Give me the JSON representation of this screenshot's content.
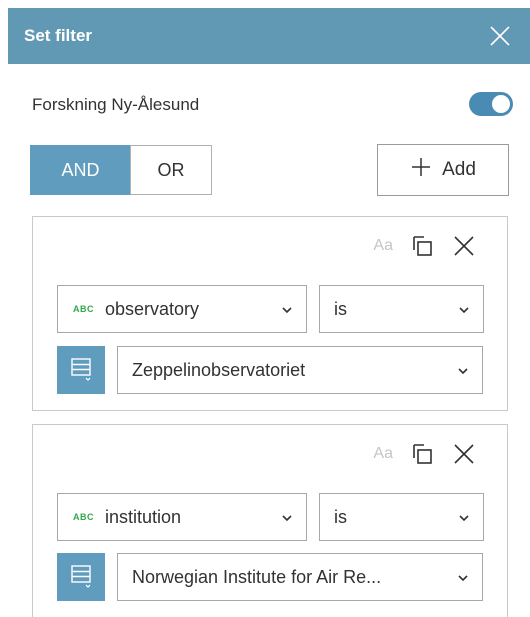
{
  "dialog": {
    "title": "Set filter",
    "close_icon": "close-icon"
  },
  "layer": {
    "name": "Forskning Ny-Ålesund",
    "enabled": true
  },
  "logic": {
    "options": [
      "AND",
      "OR"
    ],
    "selected": "AND"
  },
  "add_button": {
    "label": "Add",
    "icon": "plus-icon"
  },
  "colors": {
    "header": "#6199b4",
    "accent": "#5f9cbd",
    "toggle": "#4a8bb3",
    "string_type": "#2ea84a"
  },
  "filters": [
    {
      "field_type": "ABC",
      "field": "observatory",
      "operator": "is",
      "value": "Zeppelinobservatoriet",
      "case_label": "Aa"
    },
    {
      "field_type": "ABC",
      "field": "institution",
      "operator": "is",
      "value": "Norwegian Institute for Air Re...",
      "case_label": "Aa"
    }
  ]
}
